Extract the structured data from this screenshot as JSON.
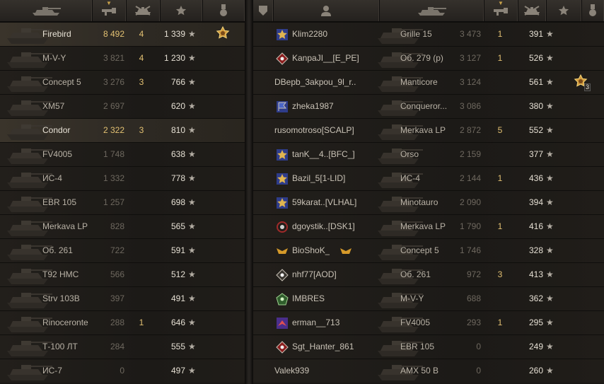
{
  "colors": {
    "accent": "#e2c072",
    "highlight_row": "#3a342b",
    "star": "#b3ada3"
  },
  "left_team": {
    "headers": [
      "vehicle-icon",
      "damage-icon",
      "frags-icon",
      "experience-icon",
      "medal-icon"
    ],
    "sort_column": "damage",
    "rows": [
      {
        "vehicle": "Firebird",
        "damage": "8 492",
        "frags": "4",
        "xp": "1 339",
        "medal": true,
        "medal_count": "",
        "highlight": true
      },
      {
        "vehicle": "M-V-Y",
        "damage": "3 821",
        "frags": "4",
        "xp": "1 230",
        "medal": false,
        "medal_count": "",
        "highlight": false
      },
      {
        "vehicle": "Concept 5",
        "damage": "3 276",
        "frags": "3",
        "xp": "766",
        "medal": false,
        "medal_count": "",
        "highlight": false
      },
      {
        "vehicle": "XM57",
        "damage": "2 697",
        "frags": "",
        "xp": "620",
        "medal": false,
        "medal_count": "",
        "highlight": false
      },
      {
        "vehicle": "Condor",
        "damage": "2 322",
        "frags": "3",
        "xp": "810",
        "medal": false,
        "medal_count": "",
        "highlight": true
      },
      {
        "vehicle": "FV4005",
        "damage": "1 748",
        "frags": "",
        "xp": "638",
        "medal": false,
        "medal_count": "",
        "highlight": false
      },
      {
        "vehicle": "ИС-4",
        "damage": "1 332",
        "frags": "",
        "xp": "778",
        "medal": false,
        "medal_count": "",
        "highlight": false
      },
      {
        "vehicle": "EBR 105",
        "damage": "1 257",
        "frags": "",
        "xp": "698",
        "medal": false,
        "medal_count": "",
        "highlight": false
      },
      {
        "vehicle": "Merkava LP",
        "damage": "828",
        "frags": "",
        "xp": "565",
        "medal": false,
        "medal_count": "",
        "highlight": false
      },
      {
        "vehicle": "Об. 261",
        "damage": "722",
        "frags": "",
        "xp": "591",
        "medal": false,
        "medal_count": "",
        "highlight": false
      },
      {
        "vehicle": "T92 HMC",
        "damage": "566",
        "frags": "",
        "xp": "512",
        "medal": false,
        "medal_count": "",
        "highlight": false
      },
      {
        "vehicle": "Strv 103B",
        "damage": "397",
        "frags": "",
        "xp": "491",
        "medal": false,
        "medal_count": "",
        "highlight": false
      },
      {
        "vehicle": "Rinoceronte",
        "damage": "288",
        "frags": "1",
        "xp": "646",
        "medal": false,
        "medal_count": "",
        "highlight": false
      },
      {
        "vehicle": "Т-100 ЛТ",
        "damage": "284",
        "frags": "",
        "xp": "555",
        "medal": false,
        "medal_count": "",
        "highlight": false
      },
      {
        "vehicle": "ИС-7",
        "damage": "0",
        "frags": "",
        "xp": "497",
        "medal": false,
        "medal_count": "",
        "highlight": false
      }
    ]
  },
  "right_team": {
    "headers": [
      "platoon-icon",
      "player-icon",
      "vehicle-icon",
      "damage-icon",
      "frags-icon",
      "experience-icon",
      "medal-icon"
    ],
    "sort_column": "damage",
    "rows": [
      {
        "player": "Klim2280",
        "badge": "gold-star",
        "vehicle": "Grille 15",
        "damage": "3 473",
        "frags": "1",
        "xp": "391",
        "medal": false,
        "medal_count": ""
      },
      {
        "player": "KanpaJI__[E_PE]",
        "badge": "red-diamond",
        "vehicle": "Об. 279 (р)",
        "damage": "3 127",
        "frags": "1",
        "xp": "526",
        "medal": false,
        "medal_count": ""
      },
      {
        "player": "DBepb_3akpou_9l_r..",
        "badge": "",
        "vehicle": "Manticore",
        "damage": "3 124",
        "frags": "",
        "xp": "561",
        "medal": true,
        "medal_count": "3"
      },
      {
        "player": "zheka1987",
        "badge": "blue-flag",
        "vehicle": "Conqueror...",
        "damage": "3 086",
        "frags": "",
        "xp": "380",
        "medal": false,
        "medal_count": ""
      },
      {
        "player": "rusomotroso[SCALP]",
        "badge": "",
        "vehicle": "Merkava LP",
        "damage": "2 872",
        "frags": "5",
        "xp": "552",
        "medal": false,
        "medal_count": ""
      },
      {
        "player": "tanK__4..[BFC_]",
        "badge": "gold-star",
        "vehicle": "Orso",
        "damage": "2 159",
        "frags": "",
        "xp": "377",
        "medal": false,
        "medal_count": ""
      },
      {
        "player": "Bazil_5[1-LID]",
        "badge": "gold-star",
        "vehicle": "ИС-4",
        "damage": "2 144",
        "frags": "1",
        "xp": "436",
        "medal": false,
        "medal_count": ""
      },
      {
        "player": "59karat..[VLHAL]",
        "badge": "gold-star",
        "vehicle": "Minotauro",
        "damage": "2 090",
        "frags": "",
        "xp": "394",
        "medal": false,
        "medal_count": ""
      },
      {
        "player": "dgoystik..[DSK1]",
        "badge": "red-wreath",
        "vehicle": "Merkava LP",
        "damage": "1 790",
        "frags": "1",
        "xp": "416",
        "medal": false,
        "medal_count": ""
      },
      {
        "player": "BioShoK_",
        "badge": "gold-wings",
        "vehicle": "Concept 5",
        "damage": "1 746",
        "frags": "",
        "xp": "328",
        "medal": false,
        "medal_count": ""
      },
      {
        "player": "nhf77[AOD]",
        "badge": "white-diamond",
        "vehicle": "Об. 261",
        "damage": "972",
        "frags": "3",
        "xp": "413",
        "medal": false,
        "medal_count": ""
      },
      {
        "player": "IMBRES",
        "badge": "green-pentagon",
        "vehicle": "M-V-Y",
        "damage": "688",
        "frags": "",
        "xp": "362",
        "medal": false,
        "medal_count": ""
      },
      {
        "player": "erman__713",
        "badge": "purple-chevron",
        "vehicle": "FV4005",
        "damage": "293",
        "frags": "1",
        "xp": "295",
        "medal": false,
        "medal_count": ""
      },
      {
        "player": "Sgt_Hanter_861",
        "badge": "red-diamond",
        "vehicle": "EBR 105",
        "damage": "0",
        "frags": "",
        "xp": "249",
        "medal": false,
        "medal_count": ""
      },
      {
        "player": "Valek939",
        "badge": "",
        "vehicle": "AMX 50 B",
        "damage": "0",
        "frags": "",
        "xp": "260",
        "medal": false,
        "medal_count": ""
      }
    ]
  }
}
